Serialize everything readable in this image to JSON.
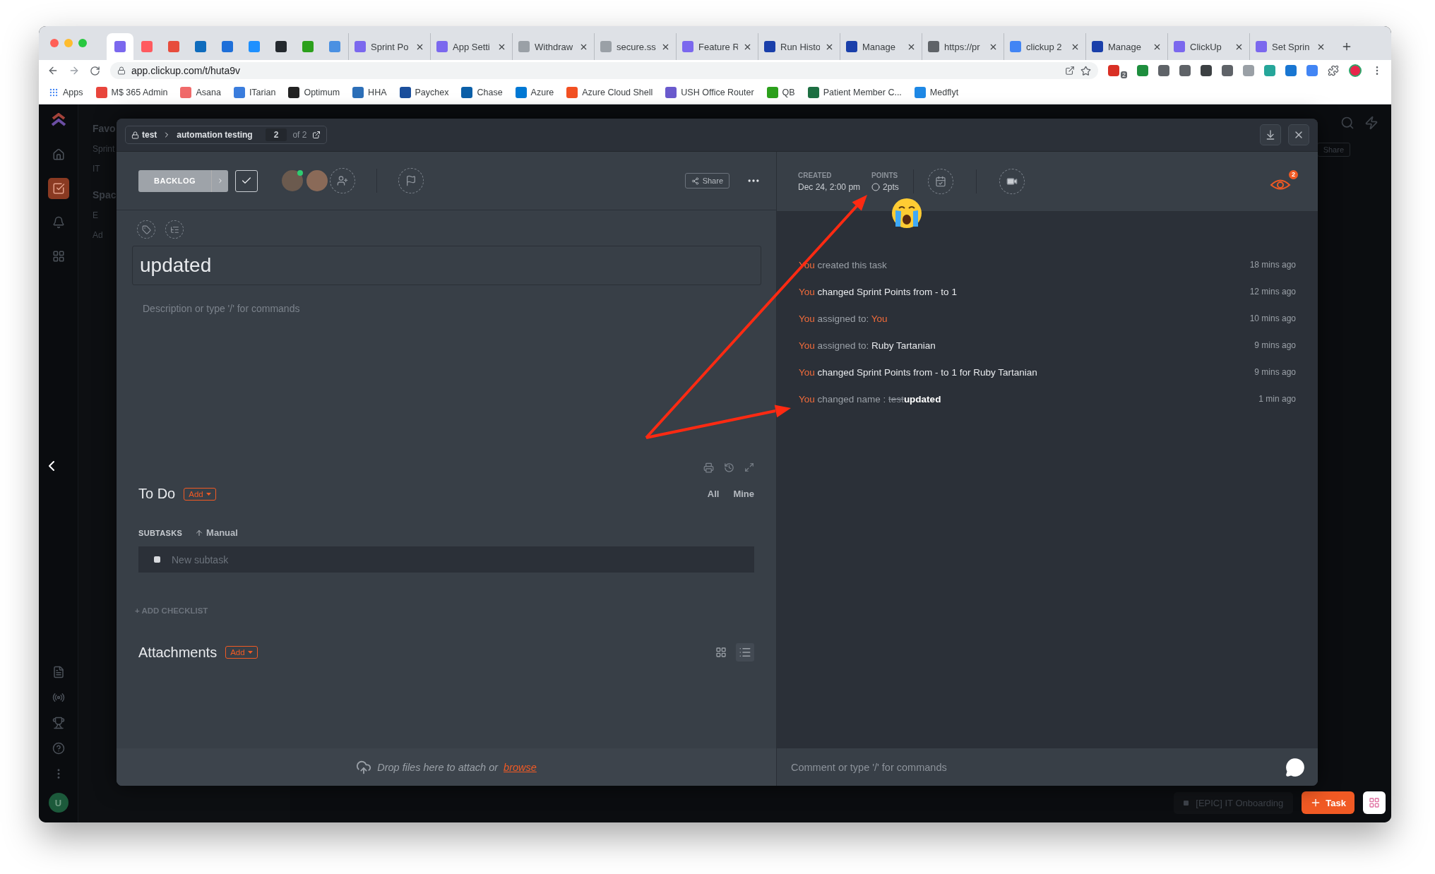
{
  "browser": {
    "pinned_tabs": [
      {
        "selected": true
      },
      {
        "selected": false
      },
      {
        "selected": false
      },
      {
        "selected": false
      },
      {
        "selected": false
      },
      {
        "selected": false
      },
      {
        "selected": false
      },
      {
        "selected": false
      },
      {
        "selected": false
      }
    ],
    "tabs": [
      {
        "title": "Sprint Po"
      },
      {
        "title": "App Setti"
      },
      {
        "title": "Withdraw"
      },
      {
        "title": "secure.ss"
      },
      {
        "title": "Feature R"
      },
      {
        "title": "Run Histo"
      },
      {
        "title": "Manage"
      },
      {
        "title": "https://pr"
      },
      {
        "title": "clickup 2"
      },
      {
        "title": "Manage"
      },
      {
        "title": "ClickUp"
      },
      {
        "title": "Set Sprin"
      }
    ],
    "address": "app.clickup.com/t/huta9v",
    "extension_badge": "2",
    "bookmarks": [
      "Apps",
      "M$ 365 Admin",
      "Asana",
      "ITarian",
      "Optimum",
      "HHA",
      "Paychex",
      "Chase",
      "Azure",
      "Azure Cloud Shell",
      "USH Office Router",
      "QB",
      "Patient Member C...",
      "Medflyt"
    ]
  },
  "rail": {
    "items": [
      {
        "kind": "home",
        "selected": false
      },
      {
        "kind": "tasks",
        "selected": true
      },
      {
        "kind": "bell",
        "selected": false
      },
      {
        "kind": "grid",
        "selected": false
      }
    ],
    "bottom": [
      {
        "kind": "doc"
      },
      {
        "kind": "broadcast"
      },
      {
        "kind": "trophy"
      },
      {
        "kind": "help"
      },
      {
        "kind": "more"
      }
    ],
    "avatar": "U"
  },
  "background": {
    "sidebar": [
      "Favo",
      "Sprint",
      "IT",
      "Spac",
      "E",
      "Ad"
    ],
    "share": "Share",
    "epic": "[EPIC] IT Onboarding",
    "task_button": "Task"
  },
  "modal": {
    "breadcrumb": [
      "test",
      "automation testing"
    ],
    "page": "2",
    "page_total": "of 2",
    "status": "BACKLOG",
    "share": "Share",
    "title": "updated",
    "description_placeholder": "Description or type '/' for commands",
    "todo": {
      "title": "To Do",
      "add": "Add",
      "filters": [
        "All",
        "Mine"
      ]
    },
    "subtasks_label": "SUBTASKS",
    "sort": "Manual",
    "subtask_placeholder": "New subtask",
    "add_checklist": "+ ADD CHECKLIST",
    "attachments": {
      "title": "Attachments",
      "add": "Add",
      "views": [
        {
          "kind": "grid",
          "selected": false
        },
        {
          "kind": "list",
          "selected": true
        }
      ]
    },
    "drop_text": "Drop files here to attach or",
    "drop_link": "browse",
    "created_label": "CREATED",
    "created": "Dec 24, 2:00 pm",
    "points_label": "POINTS",
    "points": "2pts",
    "watchers": "2",
    "activity": [
      {
        "segments": [
          {
            "kind": "actor",
            "text": "You"
          },
          {
            "kind": "muted",
            "text": " created this task"
          }
        ],
        "time": "18 mins ago"
      },
      {
        "segments": [
          {
            "kind": "actor",
            "text": "You"
          },
          {
            "kind": "plain",
            "text": " changed Sprint Points from - to 1"
          }
        ],
        "time": "12 mins ago"
      },
      {
        "segments": [
          {
            "kind": "actor",
            "text": "You"
          },
          {
            "kind": "muted",
            "text": " assigned to: "
          },
          {
            "kind": "actor",
            "text": "You"
          }
        ],
        "time": "10 mins ago"
      },
      {
        "segments": [
          {
            "kind": "actor",
            "text": "You"
          },
          {
            "kind": "muted",
            "text": " assigned to: "
          },
          {
            "kind": "plain",
            "text": "Ruby Tartanian"
          }
        ],
        "time": "9 mins ago"
      },
      {
        "segments": [
          {
            "kind": "actor",
            "text": "You"
          },
          {
            "kind": "plain",
            "text": " changed Sprint Points from - to 1 for Ruby Tartanian"
          }
        ],
        "time": "9 mins ago"
      },
      {
        "segments": [
          {
            "kind": "actor",
            "text": "You"
          },
          {
            "kind": "muted",
            "text": " changed name : "
          },
          {
            "kind": "struck",
            "text": "test"
          },
          {
            "kind": "bold",
            "text": "updated"
          }
        ],
        "time": "1 min ago"
      }
    ],
    "comment_placeholder": "Comment or type '/' for commands"
  }
}
